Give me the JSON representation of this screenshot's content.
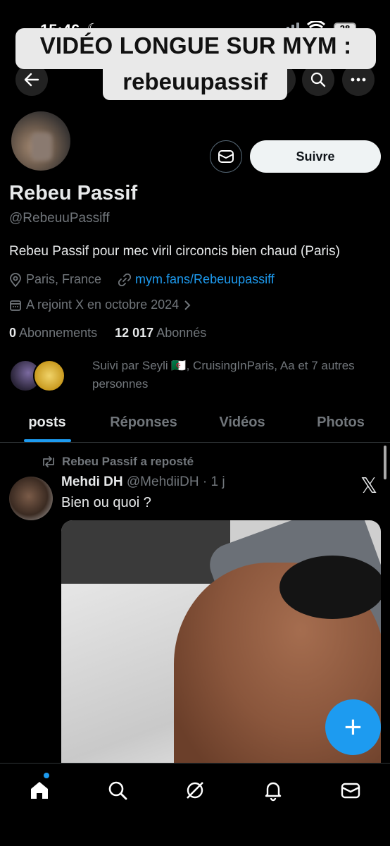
{
  "status_bar": {
    "time": "15:46",
    "battery": "28"
  },
  "overlay_caption": {
    "line1": "VIDÉO LONGUE SUR MYM :",
    "line2": "rebeuupassif"
  },
  "profile": {
    "name": "Rebeu Passif",
    "handle": "@RebeuuPassiff",
    "bio": "Rebeu Passif pour mec viril circoncis bien chaud (Paris)",
    "location": "Paris, France",
    "website": "mym.fans/Rebeuupassiff",
    "joined": "A rejoint X en octobre 2024",
    "following_count": "0",
    "following_label": "Abonnements",
    "followers_count": "12 017",
    "followers_label": "Abonnés",
    "followed_by": "Suivi par Seyli 🇩🇿, CruisingInParis, Aa et 7 autres personnes",
    "follow_label": "Suivre"
  },
  "tabs": [
    {
      "label": "posts"
    },
    {
      "label": "Réponses"
    },
    {
      "label": "Vidéos"
    },
    {
      "label": "Photos"
    }
  ],
  "post": {
    "repost_label": "Rebeu Passif a reposté",
    "author_name": "Mehdi DH",
    "author_handle": "@MehdiiDH · 1 j",
    "text": "Bien ou quoi ?"
  },
  "colors": {
    "accent": "#1d9bf0",
    "background": "#000000",
    "muted": "#71767b"
  }
}
